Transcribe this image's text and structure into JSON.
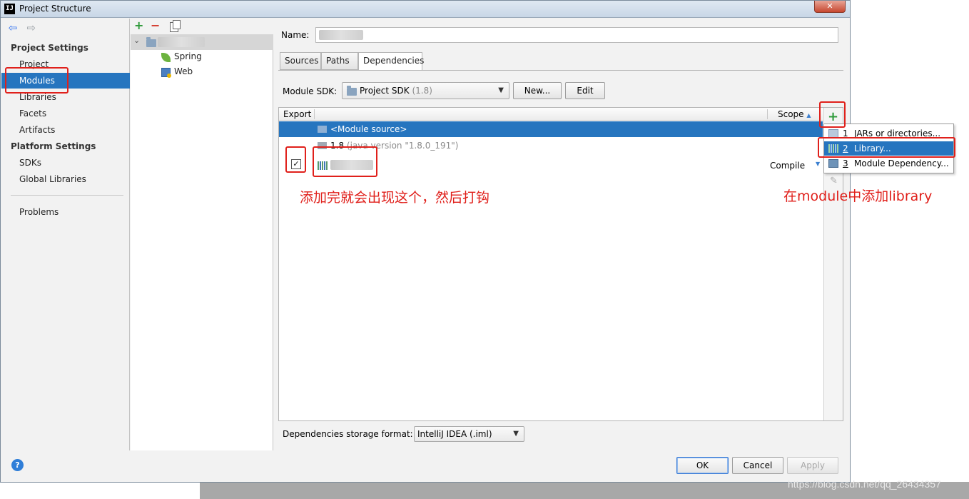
{
  "window": {
    "title": "Project Structure",
    "logo_text": "IJ",
    "close_glyph": "✕"
  },
  "nav": {
    "back_icon": "arrow-left-icon",
    "forward_icon": "arrow-right-icon",
    "project_settings_header": "Project Settings",
    "project_settings_items": [
      "Project",
      "Modules",
      "Libraries",
      "Facets",
      "Artifacts"
    ],
    "selected_item": "Modules",
    "platform_settings_header": "Platform Settings",
    "platform_settings_items": [
      "SDKs",
      "Global Libraries"
    ],
    "other_items": [
      "Problems"
    ]
  },
  "tree": {
    "toolbar": {
      "add": "+",
      "remove": "−"
    },
    "children": [
      "Spring",
      "Web"
    ]
  },
  "main": {
    "name_label": "Name:",
    "tabs": [
      "Sources",
      "Paths",
      "Dependencies"
    ],
    "active_tab": "Dependencies",
    "module_sdk_label": "Module SDK:",
    "module_sdk_value": "Project SDK",
    "module_sdk_version": "(1.8)",
    "new_button": "New...",
    "edit_button": "Edit",
    "table": {
      "header_export": "Export",
      "header_scope": "Scope",
      "rows": [
        {
          "text": "<Module source>"
        },
        {
          "text": "1.8",
          "detail": "(java version \"1.8.0_191\")"
        },
        {
          "checked": true,
          "check_glyph": "✓",
          "scope": "Compile"
        }
      ]
    },
    "side_add": "+",
    "storage_label": "Dependencies storage format:",
    "storage_value": "IntelliJ IDEA (.iml)"
  },
  "popup": {
    "items": [
      {
        "num": "1",
        "label": "JARs or directories..."
      },
      {
        "num": "2",
        "label": "Library..."
      },
      {
        "num": "3",
        "label": "Module Dependency..."
      }
    ],
    "selected_index": 1
  },
  "footer": {
    "help": "?",
    "ok": "OK",
    "cancel": "Cancel",
    "apply": "Apply"
  },
  "annotations": {
    "left_note": "添加完就会出现这个，然后打钩",
    "right_note": "在module中添加library"
  },
  "watermark": "https://blog.csdn.net/qq_26434357",
  "colors": {
    "selection": "#2675bf",
    "annotation_red": "#e0201b",
    "add_green": "#2e9a3a"
  }
}
